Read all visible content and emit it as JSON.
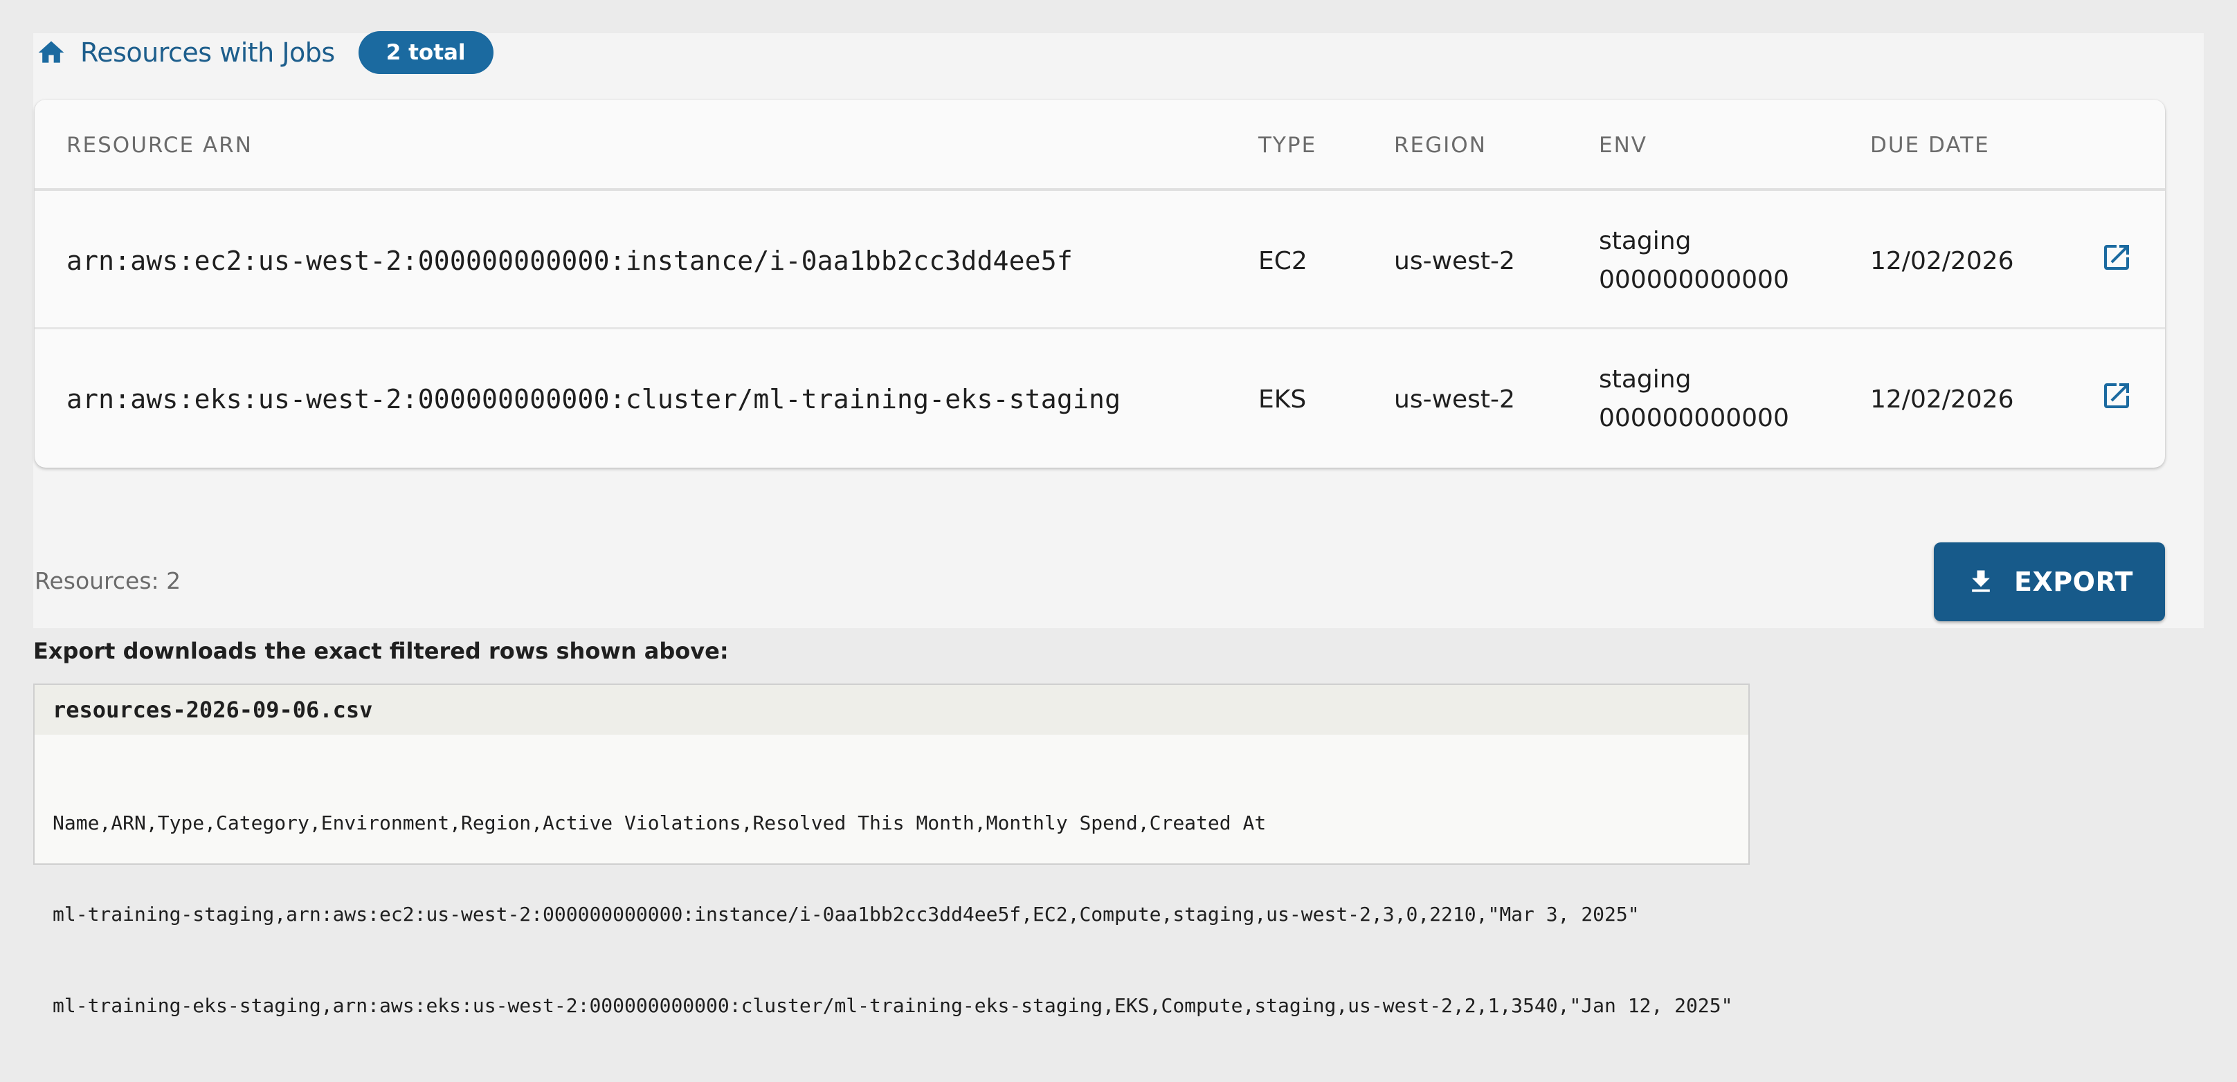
{
  "header": {
    "title": "Resources with Jobs",
    "badge": "2 total",
    "icon": "home-icon"
  },
  "colors": {
    "accent": "#1b6aa0",
    "button": "#175a8a",
    "link_icon": "#1b6aa0"
  },
  "table": {
    "columns": {
      "arn": "RESOURCE ARN",
      "type": "TYPE",
      "region": "REGION",
      "env": "ENV",
      "due_date": "DUE DATE"
    },
    "rows": [
      {
        "arn": "arn:aws:ec2:us-west-2:000000000000:instance/i-0aa1bb2cc3dd4ee5f",
        "type": "EC2",
        "region": "us-west-2",
        "env": "staging",
        "account": "000000000000",
        "due_date": "12/02/2026",
        "action_icon": "open-in-new-icon"
      },
      {
        "arn": "arn:aws:eks:us-west-2:000000000000:cluster/ml-training-eks-staging",
        "type": "EKS",
        "region": "us-west-2",
        "env": "staging",
        "account": "000000000000",
        "due_date": "12/02/2026",
        "action_icon": "open-in-new-icon"
      }
    ]
  },
  "footer": {
    "resources_count": "Resources: 2",
    "export_label": "EXPORT",
    "export_icon": "download-icon"
  },
  "note": "Export downloads the exact filtered rows shown above:",
  "file": {
    "name": "resources-2026-09-06.csv",
    "lines": [
      "Name,ARN,Type,Category,Environment,Region,Active Violations,Resolved This Month,Monthly Spend,Created At",
      "ml-training-staging,arn:aws:ec2:us-west-2:000000000000:instance/i-0aa1bb2cc3dd4ee5f,EC2,Compute,staging,us-west-2,3,0,2210,\"Mar 3, 2025\"",
      "ml-training-eks-staging,arn:aws:eks:us-west-2:000000000000:cluster/ml-training-eks-staging,EKS,Compute,staging,us-west-2,2,1,3540,\"Jan 12, 2025\""
    ]
  }
}
